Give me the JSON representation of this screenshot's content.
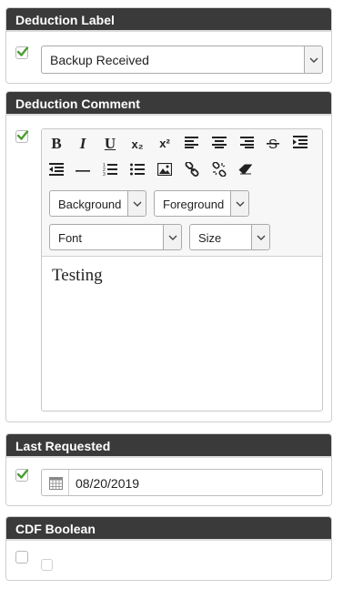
{
  "deduction_label": {
    "header": "Deduction Label",
    "checked": true,
    "select_value": "Backup Received"
  },
  "deduction_comment": {
    "header": "Deduction Comment",
    "checked": true,
    "toolbar": {
      "bold": "B",
      "italic": "I",
      "underline": "U",
      "subscript": "x₂",
      "superscript": "x²",
      "background_label": "Background",
      "foreground_label": "Foreground",
      "font_label": "Font",
      "size_label": "Size"
    },
    "content": "Testing"
  },
  "last_requested": {
    "header": "Last Requested",
    "checked": true,
    "date_value": "08/20/2019"
  },
  "cdf_boolean": {
    "header": "CDF Boolean",
    "checked": false
  },
  "colors": {
    "header_bg": "#3a3a3a",
    "check_green": "#4a9d2f"
  }
}
